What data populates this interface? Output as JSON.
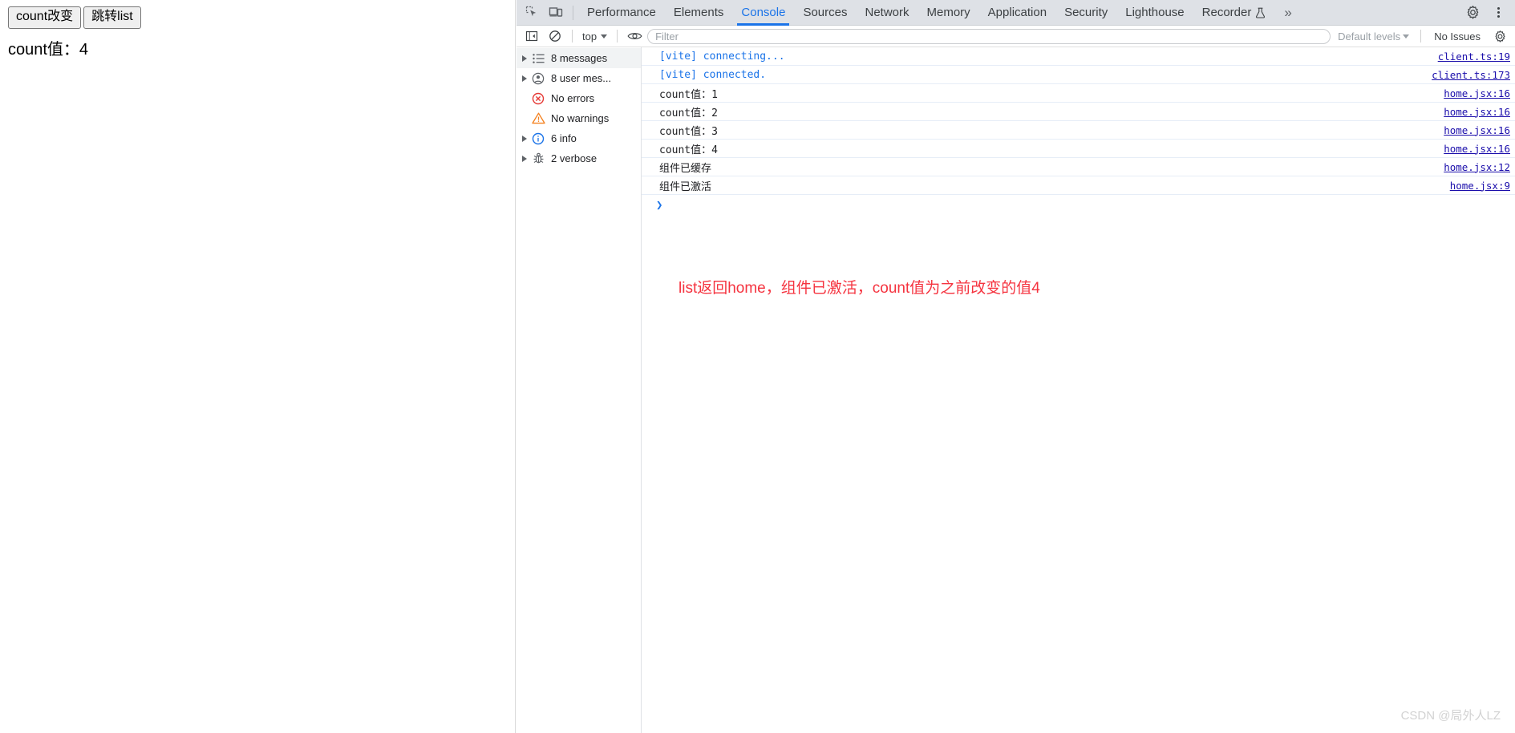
{
  "page": {
    "buttons": [
      {
        "label": "count改变",
        "name": "count-change-button"
      },
      {
        "label": "跳转list",
        "name": "goto-list-button"
      }
    ],
    "count_line": "count值：4"
  },
  "devtools": {
    "toolbar_icons": {
      "inspect": "inspect-element-icon",
      "device": "device-toolbar-icon"
    },
    "tabs": [
      {
        "label": "Performance",
        "active": false
      },
      {
        "label": "Elements",
        "active": false
      },
      {
        "label": "Console",
        "active": true
      },
      {
        "label": "Sources",
        "active": false
      },
      {
        "label": "Network",
        "active": false
      },
      {
        "label": "Memory",
        "active": false
      },
      {
        "label": "Application",
        "active": false
      },
      {
        "label": "Security",
        "active": false
      },
      {
        "label": "Lighthouse",
        "active": false
      },
      {
        "label": "Recorder",
        "active": false,
        "badge": "flask-icon"
      }
    ],
    "more_tabs_label": "»",
    "settings_icon": "gear-icon",
    "more_options_icon": "kebab-menu-icon",
    "console_toolbar": {
      "sidebar_toggle_icon": "show-console-sidebar-icon",
      "clear_icon": "clear-console-icon",
      "context": "top",
      "eye_icon": "live-expression-icon",
      "filter_placeholder": "Filter",
      "filter_value": "",
      "levels_label": "Default levels",
      "issues_label": "No Issues"
    },
    "sidebar": [
      {
        "label": "8 messages",
        "icon": "list-icon",
        "expandable": true,
        "selected": true
      },
      {
        "label": "8 user mes...",
        "icon": "user-icon",
        "expandable": true,
        "selected": false
      },
      {
        "label": "No errors",
        "icon": "error-icon",
        "expandable": false,
        "selected": false
      },
      {
        "label": "No warnings",
        "icon": "warning-icon",
        "expandable": false,
        "selected": false
      },
      {
        "label": "6 info",
        "icon": "info-icon",
        "expandable": true,
        "selected": false
      },
      {
        "label": "2 verbose",
        "icon": "verbose-bug-icon",
        "expandable": true,
        "selected": false
      }
    ],
    "messages": [
      {
        "text": "[vite] connecting...",
        "style": "vite",
        "source": "client.ts:19"
      },
      {
        "text": "[vite] connected.",
        "style": "vite",
        "source": "client.ts:173"
      },
      {
        "text": "count值：1",
        "style": "plain",
        "source": "home.jsx:16"
      },
      {
        "text": "count值：2",
        "style": "plain",
        "source": "home.jsx:16"
      },
      {
        "text": "count值：3",
        "style": "plain",
        "source": "home.jsx:16"
      },
      {
        "text": "count值：4",
        "style": "plain",
        "source": "home.jsx:16"
      },
      {
        "text": "组件已缓存",
        "style": "plain",
        "source": "home.jsx:12"
      },
      {
        "text": "组件已激活",
        "style": "plain",
        "source": "home.jsx:9"
      }
    ],
    "prompt_caret": "❯",
    "annotation": "list返回home，组件已激活，count值为之前改变的值4",
    "watermark": "CSDN @局外人LZ"
  },
  "colors": {
    "accent": "#1a73e8",
    "tabbar_bg": "#dee1e6",
    "link": "#1a0dab",
    "annotation": "#f5333f",
    "watermark": "#d2d2d2"
  }
}
